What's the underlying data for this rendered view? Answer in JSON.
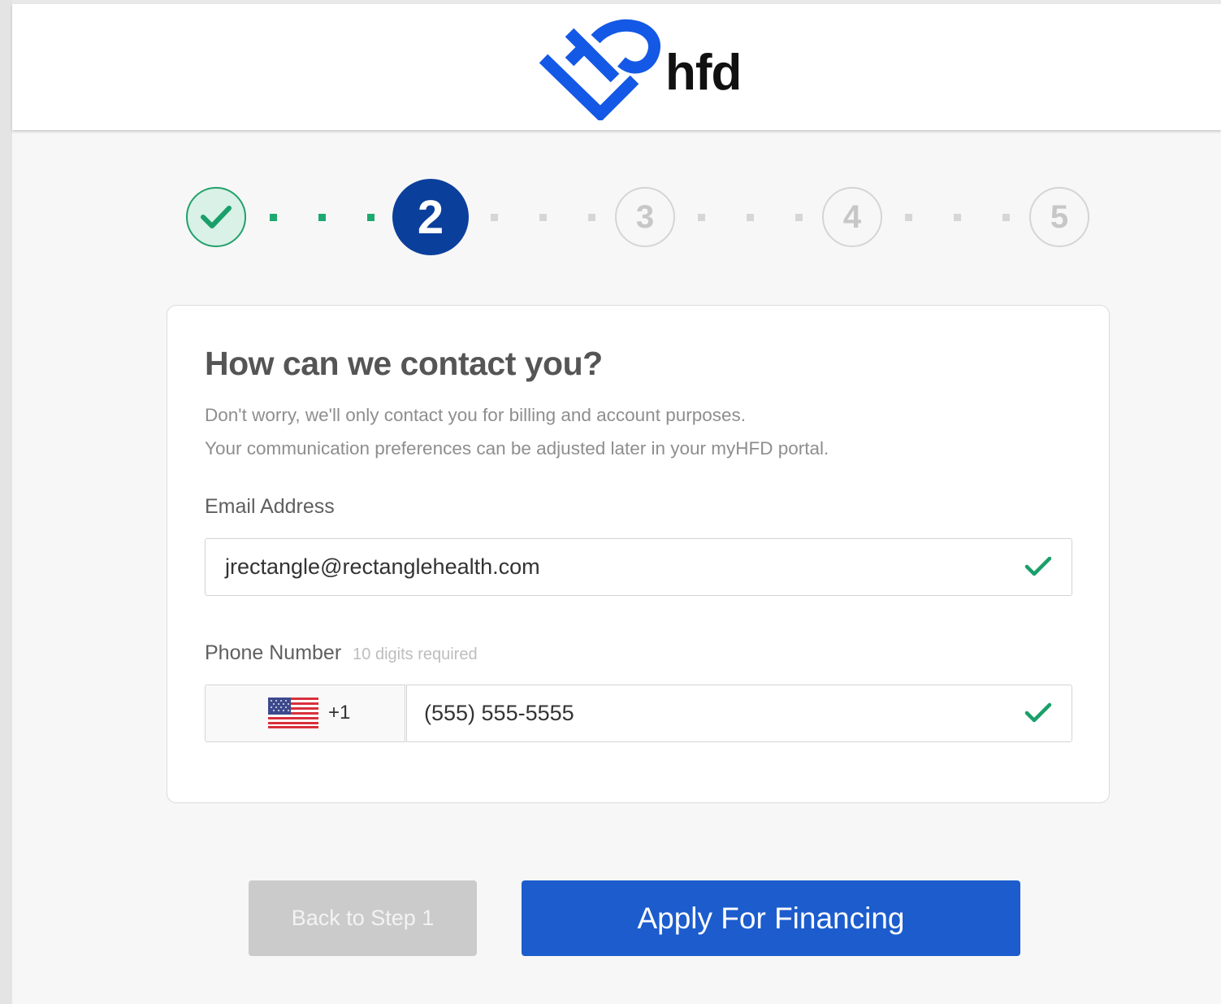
{
  "brand": {
    "name": "hfd",
    "color": "#1458e6"
  },
  "stepper": {
    "completed_step": "1",
    "current_step": "2",
    "steps": [
      "1",
      "2",
      "3",
      "4",
      "5"
    ],
    "colors": {
      "done": "#22a06b",
      "active": "#0b3f9c",
      "pending": "#d5d5d5"
    }
  },
  "form": {
    "title": "How can we contact you?",
    "subtitle_line1": "Don't worry, we'll only contact you for billing and account purposes.",
    "subtitle_line2": "Your communication preferences can be adjusted later in your myHFD portal.",
    "email": {
      "label": "Email Address",
      "value": "jrectangle@rectanglehealth.com",
      "valid_icon": "check-icon"
    },
    "phone": {
      "label": "Phone Number",
      "hint": "10 digits required",
      "country_flag": "us-flag-icon",
      "dial_code": "+1",
      "value": "(555) 555-5555",
      "valid_icon": "check-icon"
    }
  },
  "actions": {
    "back_label": "Back to Step 1",
    "apply_label": "Apply For Financing",
    "apply_color": "#1c5ccd"
  }
}
